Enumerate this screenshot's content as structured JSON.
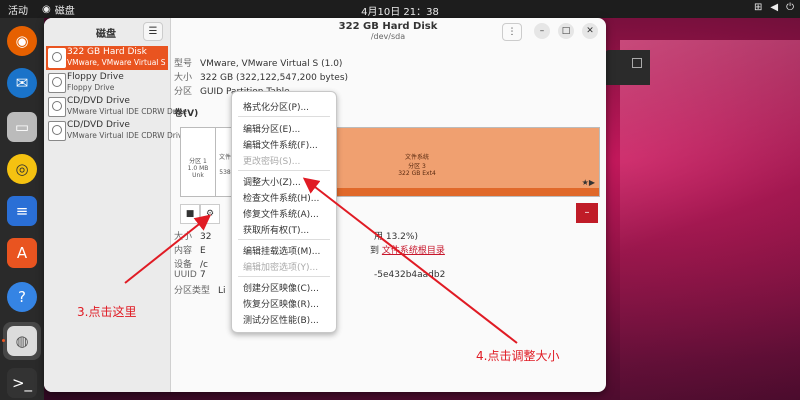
{
  "topbar": {
    "activities": "活动",
    "app_name": "磁盘",
    "clock": "4月10日  21：38"
  },
  "sidebar": {
    "title": "磁盘",
    "disks": [
      {
        "name": "322 GB Hard Disk",
        "sub": "VMware, VMware Virtual S"
      },
      {
        "name": "Floppy Drive",
        "sub": "Floppy Drive"
      },
      {
        "name": "CD/DVD Drive",
        "sub": "VMware Virtual IDE CDRW Drive"
      },
      {
        "name": "CD/DVD Drive",
        "sub": "VMware Virtual IDE CDRW Drive"
      }
    ]
  },
  "main": {
    "title": "322 GB Hard Disk",
    "subtitle": "/dev/sda",
    "info": [
      {
        "k": "型号",
        "v": "VMware, VMware Virtual S (1.0)"
      },
      {
        "k": "大小",
        "v": "322 GB (322,122,547,200 bytes)"
      },
      {
        "k": "分区",
        "v": "GUID Partition Table"
      }
    ],
    "volumes_label": "卷(V)",
    "partitions": [
      {
        "label": "分区 1",
        "size": "1.0 MB Unk"
      },
      {
        "label": "文件",
        "size": "538"
      },
      {
        "label": "文件系统",
        "sub": "分区 3",
        "size": "322 GB Ext4"
      }
    ],
    "details": [
      {
        "k": "大小",
        "v": "32",
        "extra": "用 13.2%)"
      },
      {
        "k": "内容",
        "v": "E",
        "extra_pre": "到 ",
        "link": "文件系统根目录"
      },
      {
        "k": "设备",
        "v": "/c"
      },
      {
        "k": "UUID",
        "v": "7",
        "extra": "-5e432b4aadb2"
      },
      {
        "k": "分区类型",
        "v": "Li"
      }
    ]
  },
  "context_menu": {
    "items": [
      {
        "label": "格式化分区(P)...",
        "disabled": false
      },
      {
        "label": "编辑分区(E)...",
        "disabled": false
      },
      {
        "label": "编辑文件系统(F)...",
        "disabled": false
      },
      {
        "label": "更改密码(S)...",
        "disabled": true
      },
      {
        "label": "调整大小(Z)...",
        "disabled": false
      },
      {
        "label": "检查文件系统(H)...",
        "disabled": false
      },
      {
        "label": "修复文件系统(A)...",
        "disabled": false
      },
      {
        "label": "获取所有权(T)...",
        "disabled": false
      },
      {
        "label": "编辑挂载选项(M)...",
        "disabled": false
      },
      {
        "label": "编辑加密选项(Y)...",
        "disabled": true
      },
      {
        "label": "创建分区映像(C)...",
        "disabled": false
      },
      {
        "label": "恢复分区映像(R)...",
        "disabled": false
      },
      {
        "label": "测试分区性能(B)...",
        "disabled": false
      }
    ]
  },
  "annotations": {
    "step3": "3.点击这里",
    "step4": "4.点击调整大小"
  },
  "colors": {
    "accent": "#e95420",
    "annotation": "#e01b24",
    "danger": "#c01c28"
  }
}
